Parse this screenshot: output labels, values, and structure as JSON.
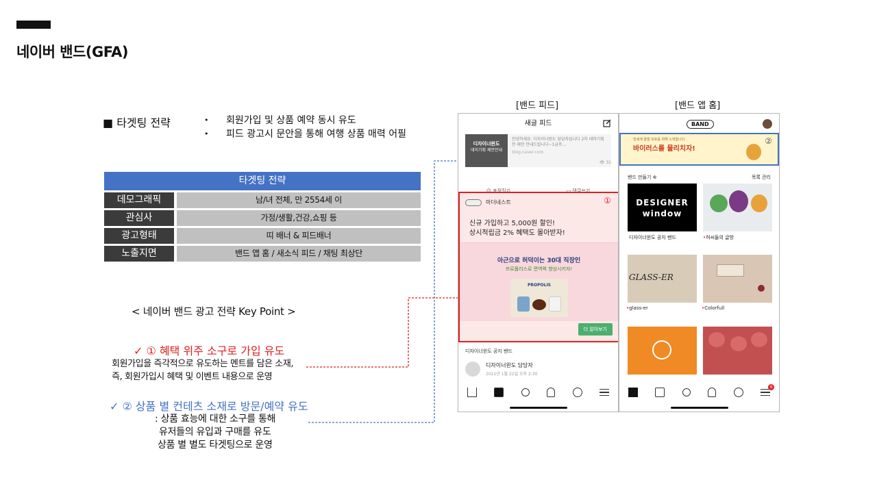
{
  "page": {
    "title": "네이버 밴드(GFA)"
  },
  "strategy": {
    "heading": "■ 타겟팅 전략",
    "bullets": [
      "회원가입 및 상품 예약 동시 유도",
      "피드 광고시 문안을 통해 여행 상품  매력 어필"
    ]
  },
  "targeting_table": {
    "header": "타겟팅 전략",
    "rows": [
      {
        "key": "데모그래픽",
        "value": "남/녀 전체, 만 2554세 이"
      },
      {
        "key": "관심사",
        "value": "가정/생활,건강,쇼핑 등"
      },
      {
        "key": "광고형태",
        "value": "띠 배너 & 피드배너"
      },
      {
        "key": "노출지면",
        "value": "밴드 앱 홈 / 새소식 피드 / 채팅 최상단"
      }
    ]
  },
  "keypoints": {
    "title": "< 네이버 밴드 광고 전략 Key Point >",
    "kp1": {
      "title": "✓  ①  혜택 위주 소구로 가입 유도",
      "lines": [
        "회원가입을 즉각적으로 유도하는 멘트를 담은 소재,",
        "즉, 회원가입시 혜택 및 이벤트 내용으로 운영"
      ]
    },
    "kp2": {
      "title": "✓ ②  상품 별 컨테츠 소재로 방문/예약 유도",
      "lines": [
        ": 상품 효능에 대한  소구를 통해",
        "유저들의 유입과 구매를 유도",
        "상품 별 별도 타겟팅으로 운영"
      ]
    }
  },
  "feed_phone": {
    "label": "[밴드 피드]",
    "header": "새글 피드",
    "preview_brand": "디자이너윈도",
    "preview_sub": "데이기획 제안안내",
    "preview_text": "안녕하세요. 디자이너윈도 담당자입니다 2차 테마기획전 제안 안내드립니다~1금주…",
    "preview_url": "blog.naver.com",
    "view_count": "31",
    "action_emote": "표정짓기",
    "action_comment": "댓글쓰기",
    "ad": {
      "brand": "마더네스트",
      "number": "①",
      "copy_line1": "신규 가입하고 5,000원 할인!",
      "copy_line2": "상시적립금 2% 혜택도 몰아받자!",
      "image_title": "아근으로 허덕이는 30대 직장인",
      "image_sub": "프로폴리스로 면역력 향상시키자!",
      "product_name": "PROPOLIS",
      "cta": "더 알아보기"
    },
    "notice_band": "디자이너윈도 공지 밴드",
    "post_author": "디자이너윈도 담당자",
    "post_date": "2021년 1월 22일 오후 2:30"
  },
  "home_phone": {
    "label": "[밴드 앱 홈]",
    "logo": "BAND",
    "banner_small": "전세계 꿀벌 보호를 위해 노력합니다",
    "banner_text": "바이러스를 물리치자!",
    "banner_number": "②",
    "section_left": "밴드 만들기",
    "section_right": "목록 관리",
    "tiles": [
      {
        "art": "DESIGNER window",
        "label": "디자이너윈도 공지 밴드",
        "dot": false
      },
      {
        "art": "",
        "label": "허씨들의 글방",
        "dot": true
      },
      {
        "art": "GLASS-ER",
        "label": "glass-er",
        "dot": true
      },
      {
        "art": "",
        "label": "Colorfull",
        "dot": true
      }
    ],
    "badge": "6"
  },
  "colors": {
    "accent_red": "#e01f1f",
    "accent_blue": "#4472c4",
    "table_dark": "#3b3b3b",
    "table_light": "#c0c0c0"
  }
}
